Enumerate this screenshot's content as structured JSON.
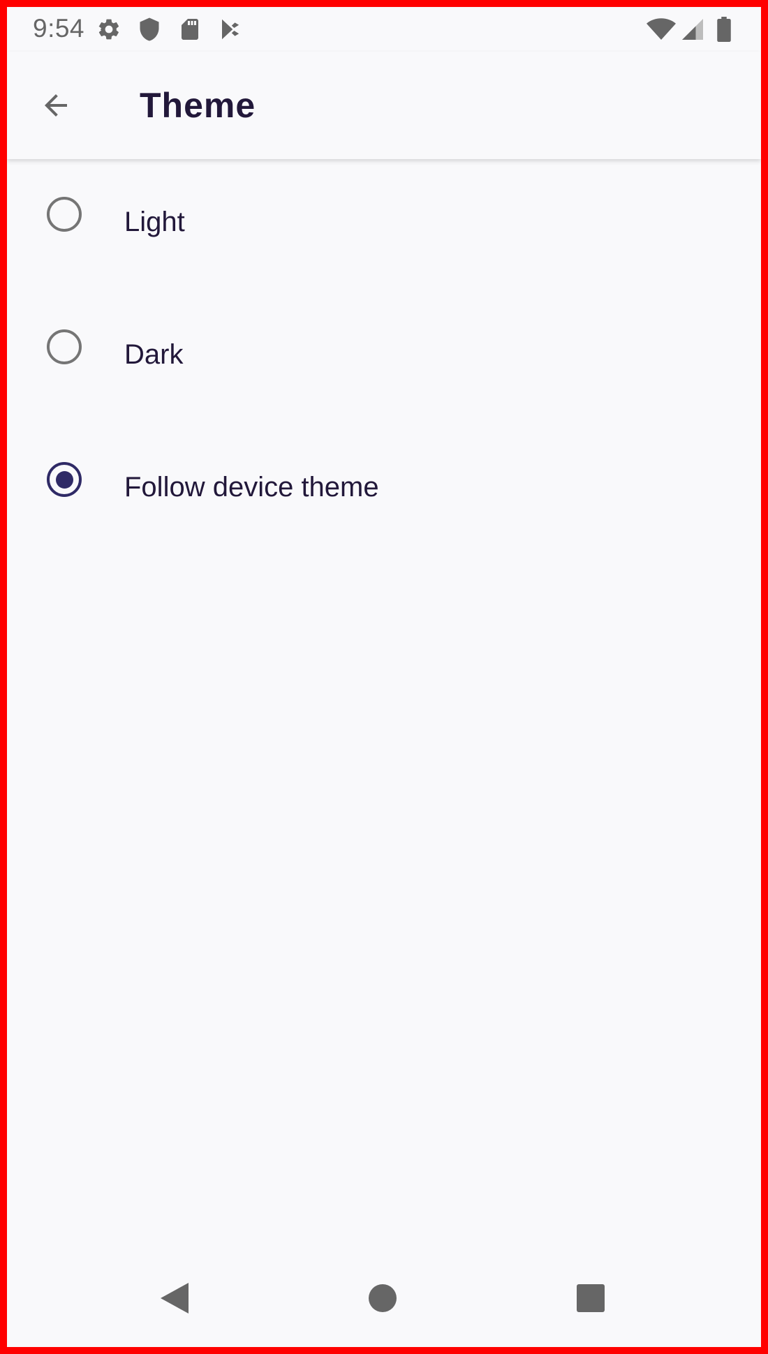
{
  "status_bar": {
    "time": "9:54",
    "left_icons": [
      "settings-icon",
      "shield-icon",
      "sd-card-icon",
      "play-store-icon"
    ],
    "right_icons": [
      "wifi-icon",
      "cell-signal-icon",
      "battery-icon"
    ]
  },
  "app_bar": {
    "back_icon": "arrow-left-icon",
    "title": "Theme"
  },
  "theme_options": [
    {
      "label": "Light",
      "selected": false
    },
    {
      "label": "Dark",
      "selected": false
    },
    {
      "label": "Follow device theme",
      "selected": true
    }
  ],
  "nav_bar": {
    "buttons": [
      "back-triangle-icon",
      "home-circle-icon",
      "recents-square-icon"
    ]
  },
  "colors": {
    "background": "#f9f9fb",
    "text_primary": "#22183a",
    "accent": "#2f2a66",
    "icon_gray": "#666666",
    "radio_unselected": "#757575",
    "frame": "#ff0000"
  }
}
